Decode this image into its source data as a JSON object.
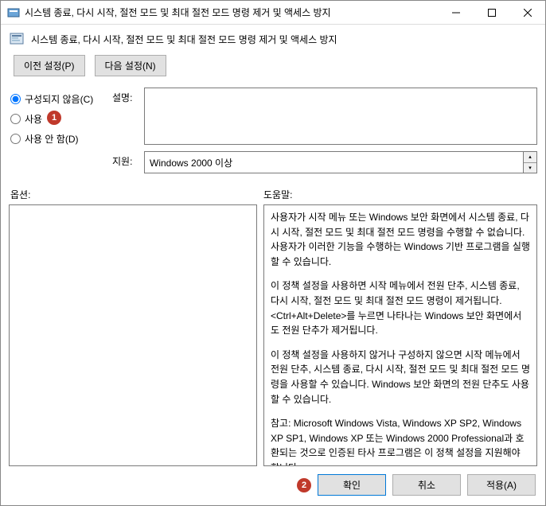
{
  "window": {
    "title": "시스템 종료, 다시 시작, 절전 모드 및 최대 절전 모드 명령 제거 및 액세스 방지"
  },
  "subheader": {
    "title": "시스템 종료, 다시 시작, 절전 모드 및 최대 절전 모드 명령 제거 및 액세스 방지"
  },
  "nav": {
    "prev": "이전 설정(P)",
    "next": "다음 설정(N)"
  },
  "radios": {
    "not_configured": "구성되지 않음(C)",
    "enabled": "사용",
    "disabled": "사용 안 함(D)"
  },
  "fields": {
    "desc_label": "설명:",
    "desc_value": "",
    "support_label": "지원:",
    "support_value": "Windows 2000 이상"
  },
  "labels": {
    "options": "옵션:",
    "help": "도움말:"
  },
  "help": {
    "p1": "사용자가 시작 메뉴 또는 Windows 보안 화면에서 시스템 종료, 다시 시작, 절전 모드 및 최대 절전 모드 명령을 수행할 수 없습니다. 사용자가 이러한 기능을 수행하는 Windows 기반 프로그램을 실행할 수 있습니다.",
    "p2": "이 정책 설정을 사용하면 시작 메뉴에서 전원 단추, 시스템 종료, 다시 시작, 절전 모드 및 최대 절전 모드 명령이 제거됩니다. <Ctrl+Alt+Delete>를 누르면 나타나는 Windows 보안 화면에서도 전원 단추가 제거됩니다.",
    "p3": "이 정책 설정을 사용하지 않거나 구성하지 않으면 시작 메뉴에서 전원 단추, 시스템 종료, 다시 시작, 절전 모드 및 최대 절전 모드 명령을 사용할 수 있습니다. Windows 보안 화면의 전원 단추도 사용할 수 있습니다.",
    "p4": "참고: Microsoft Windows Vista, Windows XP SP2, Windows XP SP1, Windows XP 또는 Windows 2000 Professional과 호환되는 것으로 인증된 타사 프로그램은 이 정책 설정을 지원해야 합니다."
  },
  "footer": {
    "ok": "확인",
    "cancel": "취소",
    "apply": "적용(A)"
  },
  "markers": {
    "m1": "1",
    "m2": "2"
  }
}
